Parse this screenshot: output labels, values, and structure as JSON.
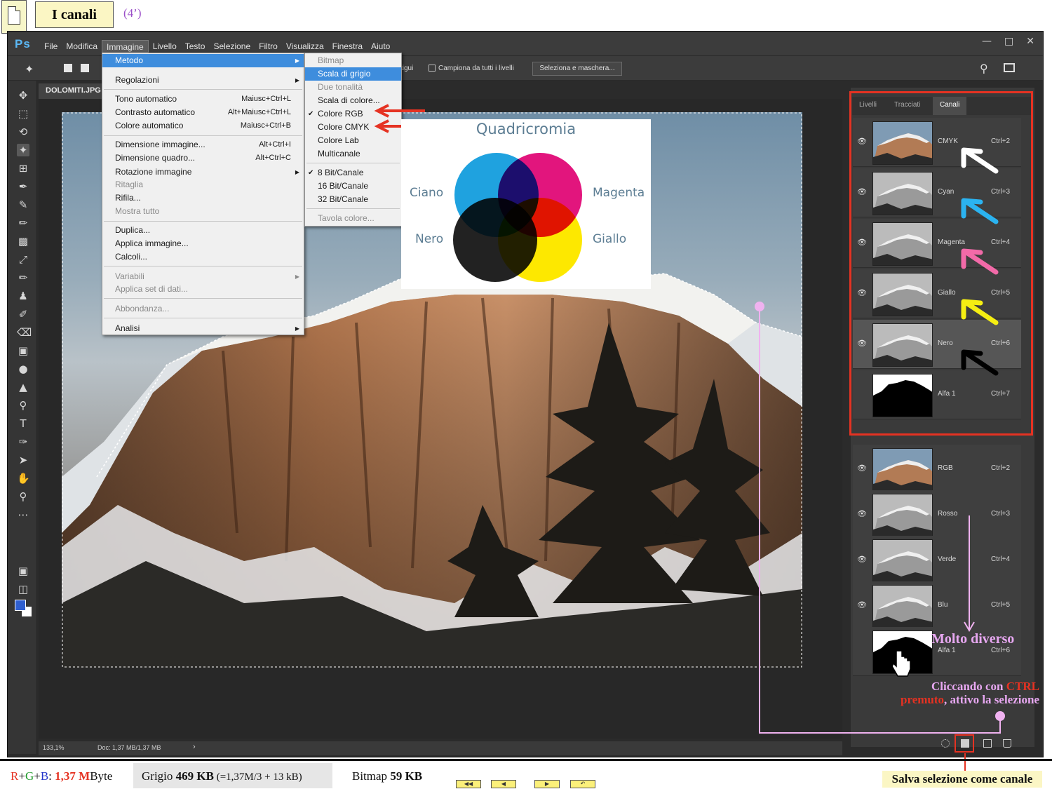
{
  "slide": {
    "title": "I canali",
    "time": "(4’)"
  },
  "ps": {
    "logo": "Ps",
    "menubar": [
      "File",
      "Modifica",
      "Immagine",
      "Livello",
      "Testo",
      "Selezione",
      "Filtro",
      "Visualizza",
      "Finestra",
      "Aiuto"
    ],
    "active_menu": "Immagine",
    "options": {
      "tutti_livelli_frag": "tigui",
      "campiona": "Campiona da tutti i livelli",
      "seleziona_maschera": "Seleziona e maschera..."
    },
    "doc_tab": "DOLOMITI.JPG",
    "status": {
      "zoom": "133,1%",
      "doc": "Doc: 1,37 MB/1,37 MB"
    }
  },
  "image_menu": {
    "metodo": "Metodo",
    "regolazioni": "Regolazioni",
    "tono": {
      "label": "Tono automatico",
      "shortcut": "Maiusc+Ctrl+L"
    },
    "contrasto": {
      "label": "Contrasto automatico",
      "shortcut": "Alt+Maiusc+Ctrl+L"
    },
    "colore": {
      "label": "Colore automatico",
      "shortcut": "Maiusc+Ctrl+B"
    },
    "dim_immagine": {
      "label": "Dimensione immagine...",
      "shortcut": "Alt+Ctrl+I"
    },
    "dim_quadro": {
      "label": "Dimensione quadro...",
      "shortcut": "Alt+Ctrl+C"
    },
    "rotazione": "Rotazione immagine",
    "ritaglia": "Ritaglia",
    "rifila": "Rifila...",
    "mostra_tutto": "Mostra tutto",
    "duplica": "Duplica...",
    "applica": "Applica immagine...",
    "calcoli": "Calcoli...",
    "variabili": "Variabili",
    "applica_set": "Applica set di dati...",
    "abbondanza": "Abbondanza...",
    "analisi": "Analisi"
  },
  "mode_menu": {
    "bitmap": "Bitmap",
    "grigio": "Scala di grigio",
    "due_tonalita": "Due tonalità",
    "scala_colore": "Scala di colore...",
    "rgb": "Colore RGB",
    "cmyk": "Colore CMYK",
    "lab": "Colore Lab",
    "multicanale": "Multicanale",
    "bit8": "8 Bit/Canale",
    "bit16": "16 Bit/Canale",
    "bit32": "32 Bit/Canale",
    "tavola": "Tavola colore..."
  },
  "quadricromia": {
    "title": "Quadricromia",
    "ciano": "Ciano",
    "magenta": "Magenta",
    "nero": "Nero",
    "giallo": "Giallo",
    "colors": {
      "cyan": "#1fa2df",
      "magenta": "#e2157d",
      "yellow": "#fde800",
      "black": "#111111"
    }
  },
  "panel": {
    "tabs": [
      "Livelli",
      "Tracciati",
      "Canali"
    ],
    "cmyk_channels": [
      {
        "name": "CMYK",
        "shortcut": "Ctrl+2"
      },
      {
        "name": "Cyan",
        "shortcut": "Ctrl+3"
      },
      {
        "name": "Magenta",
        "shortcut": "Ctrl+4"
      },
      {
        "name": "Giallo",
        "shortcut": "Ctrl+5"
      },
      {
        "name": "Nero",
        "shortcut": "Ctrl+6"
      },
      {
        "name": "Alfa 1",
        "shortcut": "Ctrl+7"
      }
    ],
    "rgb_channels": [
      {
        "name": "RGB",
        "shortcut": "Ctrl+2"
      },
      {
        "name": "Rosso",
        "shortcut": "Ctrl+3"
      },
      {
        "name": "Verde",
        "shortcut": "Ctrl+4"
      },
      {
        "name": "Blu",
        "shortcut": "Ctrl+5"
      },
      {
        "name": "Alfa 1",
        "shortcut": "Ctrl+6"
      }
    ],
    "arrow_colors": [
      "#ffffff",
      "#2bb3f0",
      "#f26aa8",
      "#f5ee12",
      "#000000"
    ]
  },
  "annotations": {
    "molto_diverso": "Molto diverso",
    "note_a": "Cliccando con ",
    "note_ctrl": "CTRL",
    "note_premuto": "premuto",
    "note_b": ", attivo la selezione",
    "salva": "Salva selezione come canale"
  },
  "footer": {
    "rgb_r": "R",
    "rgb_plus1": "+",
    "rgb_g": "G",
    "rgb_plus2": "+",
    "rgb_b": "B",
    "rgb_colon": ": ",
    "rgb_size": "1,37",
    "rgb_unit_m": " M",
    "rgb_unit": "Byte",
    "grigio_label": "Grigio ",
    "grigio_size": "469 KB",
    "grigio_note": " (=1,37M/3 + 13 kB)",
    "bitmap_label": "Bitmap ",
    "bitmap_size": "59 KB",
    "colors": {
      "r": "#e53222",
      "g": "#1f9a2a",
      "b": "#2436c9"
    }
  }
}
